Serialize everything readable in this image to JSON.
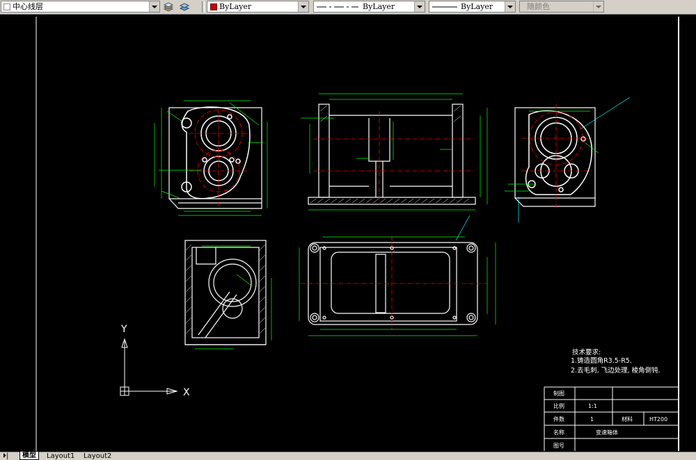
{
  "toolbar": {
    "layer_value": "中心线层",
    "color_value": "ByLayer",
    "linetype_value": "ByLayer",
    "lineweight_value": "ByLayer",
    "plotstyle_value": "随颜色"
  },
  "notes": {
    "heading": "技术要求:",
    "line1": "1.铸造圆角R3.5-R5.",
    "line2": "2.去毛刺, 飞边处理, 棱角倒钝."
  },
  "title_block": {
    "r1c1": "制图",
    "r2c1": "比例",
    "r2c2": "1:1",
    "r3c1": "件数",
    "r3c2": "1",
    "r3c3": "材料",
    "r3c4": "HT200",
    "r4c1": "名称",
    "r4c2": "变速箱体",
    "r5c1": "图号"
  },
  "ucs": {
    "y": "Y",
    "x": "X"
  },
  "tabs": [
    {
      "label": "模型"
    },
    {
      "label": "Layout1"
    },
    {
      "label": "Layout2"
    }
  ],
  "colors": {
    "background": "#000000",
    "geometry": "#ffffff",
    "dimension": "#00ff00",
    "centerline": "#ff0000",
    "border": "#ffffff",
    "leader": "#00ffff"
  }
}
